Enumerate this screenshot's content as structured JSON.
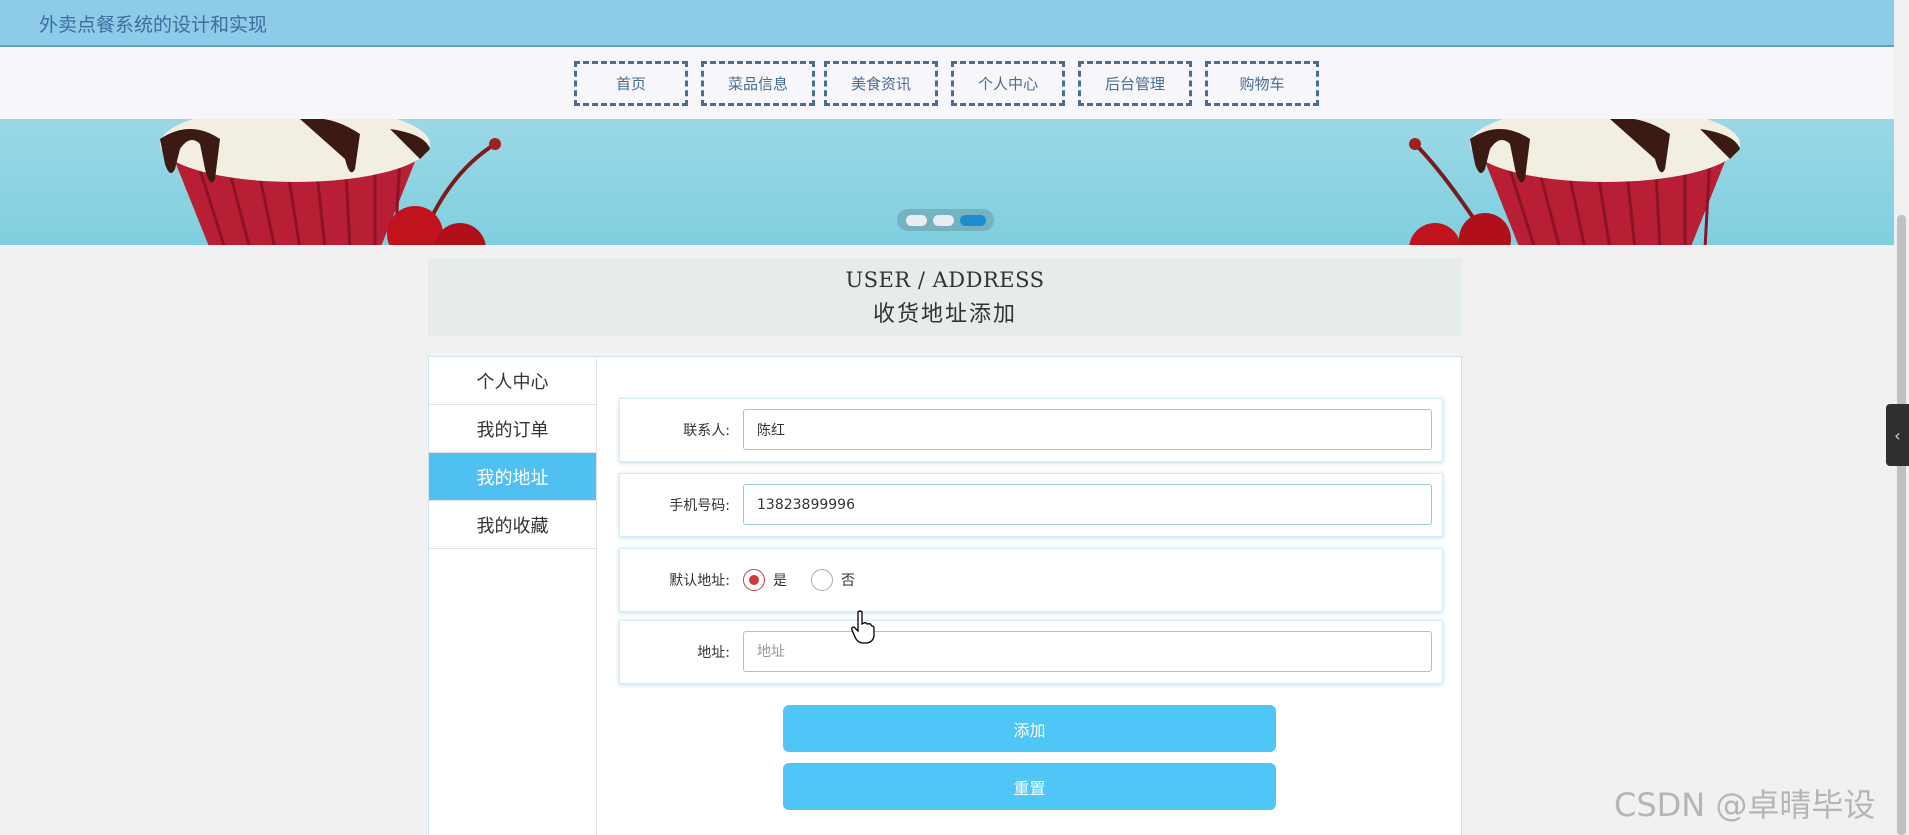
{
  "header": {
    "site_title": "外卖点餐系统的设计和实现"
  },
  "nav": {
    "items": [
      "首页",
      "菜品信息",
      "美食资讯",
      "个人中心",
      "后台管理",
      "购物车"
    ]
  },
  "heading": {
    "en": "USER / ADDRESS",
    "zh": "收货地址添加"
  },
  "sidebar": {
    "items": [
      {
        "label": "个人中心"
      },
      {
        "label": "我的订单"
      },
      {
        "label": "我的地址",
        "active": true
      },
      {
        "label": "我的收藏"
      }
    ]
  },
  "form": {
    "contact": {
      "label": "联系人:",
      "value": "陈红"
    },
    "phone": {
      "label": "手机号码:",
      "value": "13823899996"
    },
    "default_address": {
      "label": "默认地址:",
      "options": [
        "是",
        "否"
      ],
      "selected": "是"
    },
    "address": {
      "label": "地址:",
      "placeholder": "地址",
      "value": ""
    },
    "submit_label": "添加",
    "reset_label": "重置"
  },
  "colors": {
    "accent": "#4fc6f5",
    "header_bg": "#8ecbe8",
    "nav_border": "#4a6c94"
  },
  "watermark": "CSDN @卓晴毕设"
}
